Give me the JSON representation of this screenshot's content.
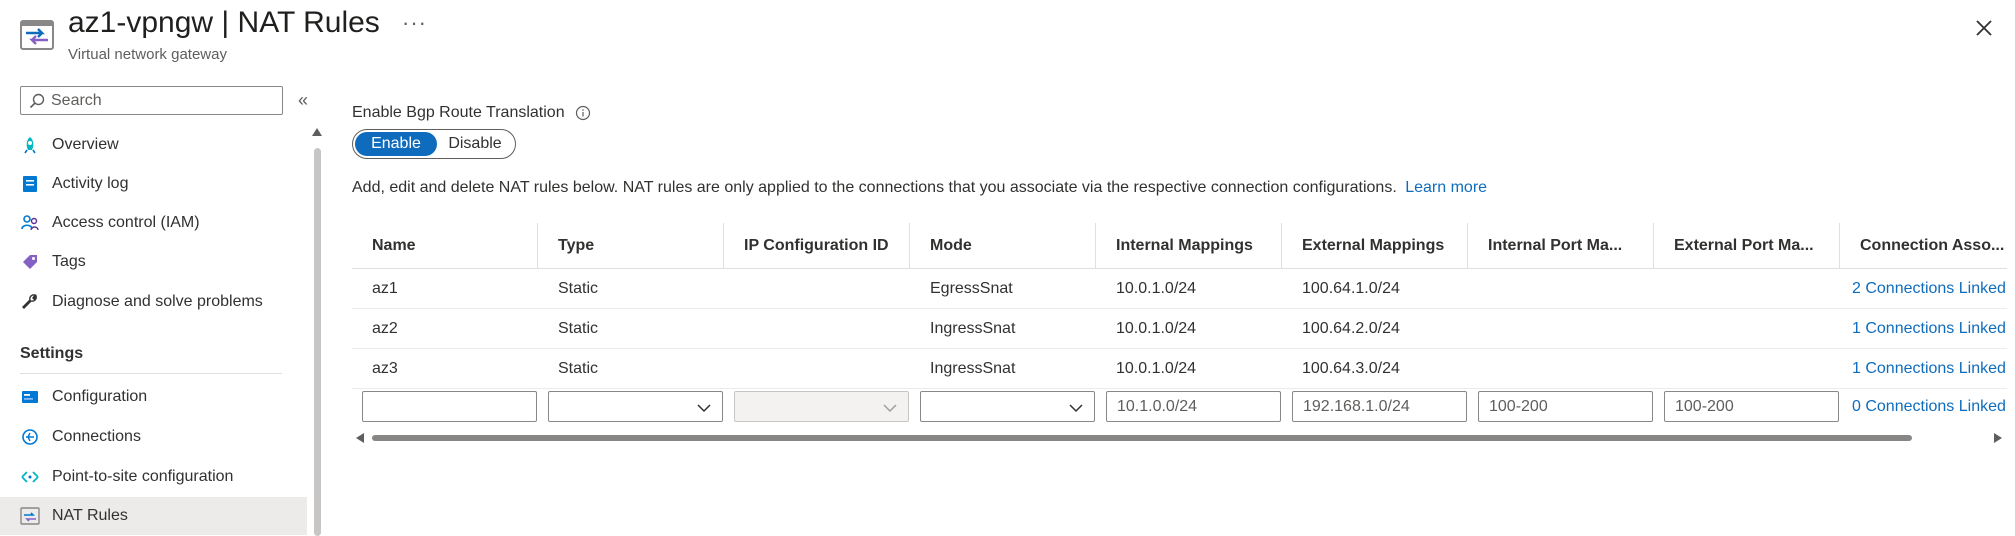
{
  "header": {
    "title": "az1-vpngw | NAT Rules",
    "subtitle": "Virtual network gateway",
    "more_label": "···"
  },
  "sidebar": {
    "search_placeholder": "Search",
    "collapse_label": "«",
    "items": [
      {
        "label": "Overview",
        "icon": "rocket-icon"
      },
      {
        "label": "Activity log",
        "icon": "activity-log-icon"
      },
      {
        "label": "Access control (IAM)",
        "icon": "people-icon"
      },
      {
        "label": "Tags",
        "icon": "tag-icon"
      },
      {
        "label": "Diagnose and solve problems",
        "icon": "wrench-icon"
      }
    ],
    "settings_heading": "Settings",
    "settings_items": [
      {
        "label": "Configuration",
        "icon": "configuration-icon"
      },
      {
        "label": "Connections",
        "icon": "connections-icon"
      },
      {
        "label": "Point-to-site configuration",
        "icon": "point-to-site-icon"
      },
      {
        "label": "NAT Rules",
        "icon": "nat-rules-icon",
        "selected": true
      }
    ]
  },
  "bgp": {
    "label": "Enable Bgp Route Translation",
    "enable_label": "Enable",
    "disable_label": "Disable",
    "selected": "Enable"
  },
  "description": {
    "text": "Add, edit and delete NAT rules below. NAT rules are only applied to the connections that you associate via the respective connection configurations.",
    "link": "Learn more"
  },
  "table": {
    "columns": [
      "Name",
      "Type",
      "IP Configuration ID",
      "Mode",
      "Internal Mappings",
      "External Mappings",
      "Internal Port Ma...",
      "External Port Ma...",
      "Connection Asso..."
    ],
    "rows": [
      {
        "name": "az1",
        "type": "Static",
        "ipconfig": "",
        "mode": "EgressSnat",
        "internal": "10.0.1.0/24",
        "external": "100.64.1.0/24",
        "int_port": "",
        "ext_port": "",
        "connections": "2 Connections Linked"
      },
      {
        "name": "az2",
        "type": "Static",
        "ipconfig": "",
        "mode": "IngressSnat",
        "internal": "10.0.1.0/24",
        "external": "100.64.2.0/24",
        "int_port": "",
        "ext_port": "",
        "connections": "1 Connections Linked"
      },
      {
        "name": "az3",
        "type": "Static",
        "ipconfig": "",
        "mode": "IngressSnat",
        "internal": "10.0.1.0/24",
        "external": "100.64.3.0/24",
        "int_port": "",
        "ext_port": "",
        "connections": "1 Connections Linked"
      }
    ],
    "new_row": {
      "name_value": "",
      "type_value": "",
      "ipconfig_value": "",
      "mode_value": "",
      "internal_placeholder": "10.1.0.0/24",
      "external_placeholder": "192.168.1.0/24",
      "int_port_placeholder": "100-200",
      "ext_port_placeholder": "100-200",
      "connections": "0 Connections Linked"
    }
  },
  "colors": {
    "accent": "#0f6cbd",
    "text": "#323130",
    "muted": "#605e5c",
    "selected_bg": "#edebe9"
  }
}
